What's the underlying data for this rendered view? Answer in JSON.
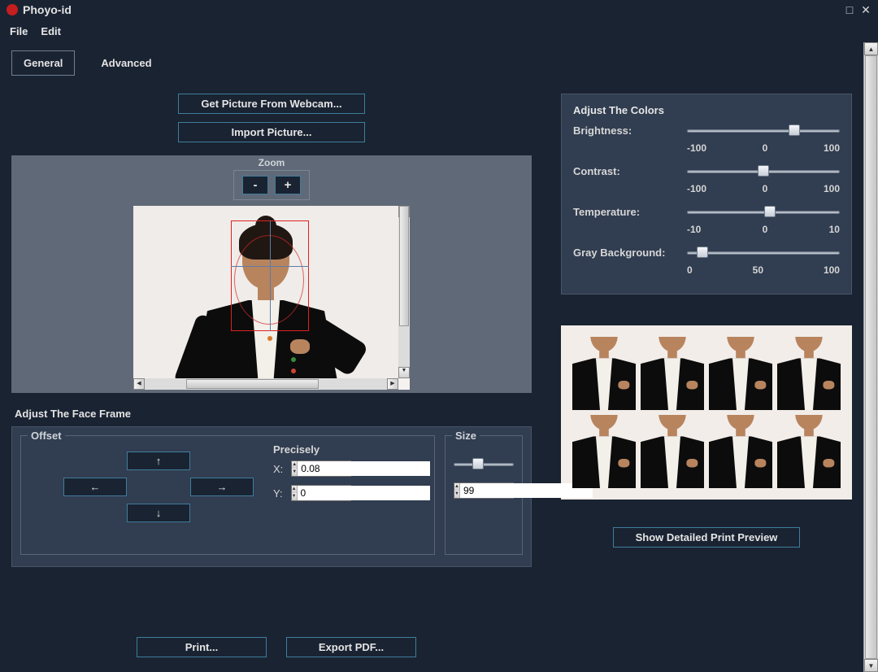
{
  "window": {
    "title": "Phoyo-id"
  },
  "menu": {
    "file": "File",
    "edit": "Edit"
  },
  "tabs": {
    "general": "General",
    "advanced": "Advanced"
  },
  "buttons": {
    "webcam": "Get Picture From Webcam...",
    "import": "Import Picture...",
    "print": "Print...",
    "export": "Export PDF...",
    "preview": "Show Detailed Print Preview"
  },
  "zoom": {
    "label": "Zoom",
    "minus": "-",
    "plus": "+"
  },
  "faceframe": {
    "title": "Adjust The Face Frame",
    "offset_label": "Offset",
    "up": "↑",
    "down": "↓",
    "left": "←",
    "right": "→",
    "precisely_label": "Precisely",
    "x_label": "X:",
    "x_value": "0.08",
    "y_label": "Y:",
    "y_value": "0",
    "size_label": "Size",
    "size_value": "99",
    "size_pos": 40
  },
  "colors": {
    "title": "Adjust The Colors",
    "brightness": {
      "label": "Brightness:",
      "min": "-100",
      "mid": "0",
      "max": "100",
      "pos": 70
    },
    "contrast": {
      "label": "Contrast:",
      "min": "-100",
      "mid": "0",
      "max": "100",
      "pos": 50
    },
    "temperature": {
      "label": "Temperature:",
      "min": "-10",
      "mid": "0",
      "max": "10",
      "pos": 54
    },
    "graybg": {
      "label": "Gray Background:",
      "min": "0",
      "mid": "50",
      "max": "100",
      "pos": 10
    }
  }
}
